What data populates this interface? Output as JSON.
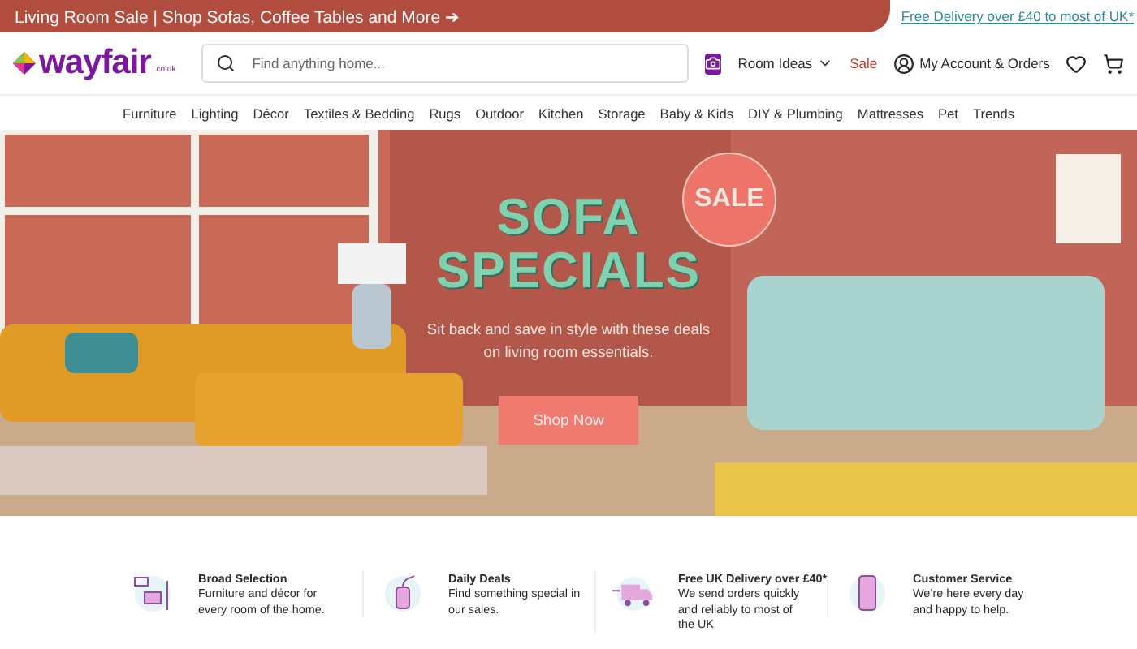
{
  "promo_bar": {
    "text": "Living Room Sale | Shop Sofas, Coffee Tables and More ➔",
    "link": "Free Delivery over £40 to most of UK*"
  },
  "header": {
    "logo": "wayfair",
    "logo_suffix": ".co.uk",
    "search": {
      "placeholder": "Find anything home..."
    },
    "room_ideas": "Room Ideas",
    "sale": "Sale",
    "account": "My Account & Orders"
  },
  "nav": [
    "Furniture",
    "Lighting",
    "Décor",
    "Textiles & Bedding",
    "Rugs",
    "Outdoor",
    "Kitchen",
    "Storage",
    "Baby & Kids",
    "DIY & Plumbing",
    "Mattresses",
    "Pet",
    "Trends"
  ],
  "hero": {
    "badge": "SALE",
    "title_lines": [
      "SOFA",
      "SPECIALS"
    ],
    "subtitle": "Sit back and save in style with these deals on living room essentials.",
    "button": "Shop Now"
  },
  "features": [
    {
      "kind": "furniture",
      "title": "Broad Selection",
      "text": "Furniture and décor for every room of the home."
    },
    {
      "kind": "tag",
      "title": "Daily Deals",
      "text": "Find something special in our sales."
    },
    {
      "kind": "truck",
      "title": "Free UK Delivery over £40*",
      "text": "We send orders quickly and reliably to most of the UK"
    },
    {
      "kind": "phone",
      "title": "Customer Service",
      "text": "We’re here every day and happy to help."
    }
  ]
}
